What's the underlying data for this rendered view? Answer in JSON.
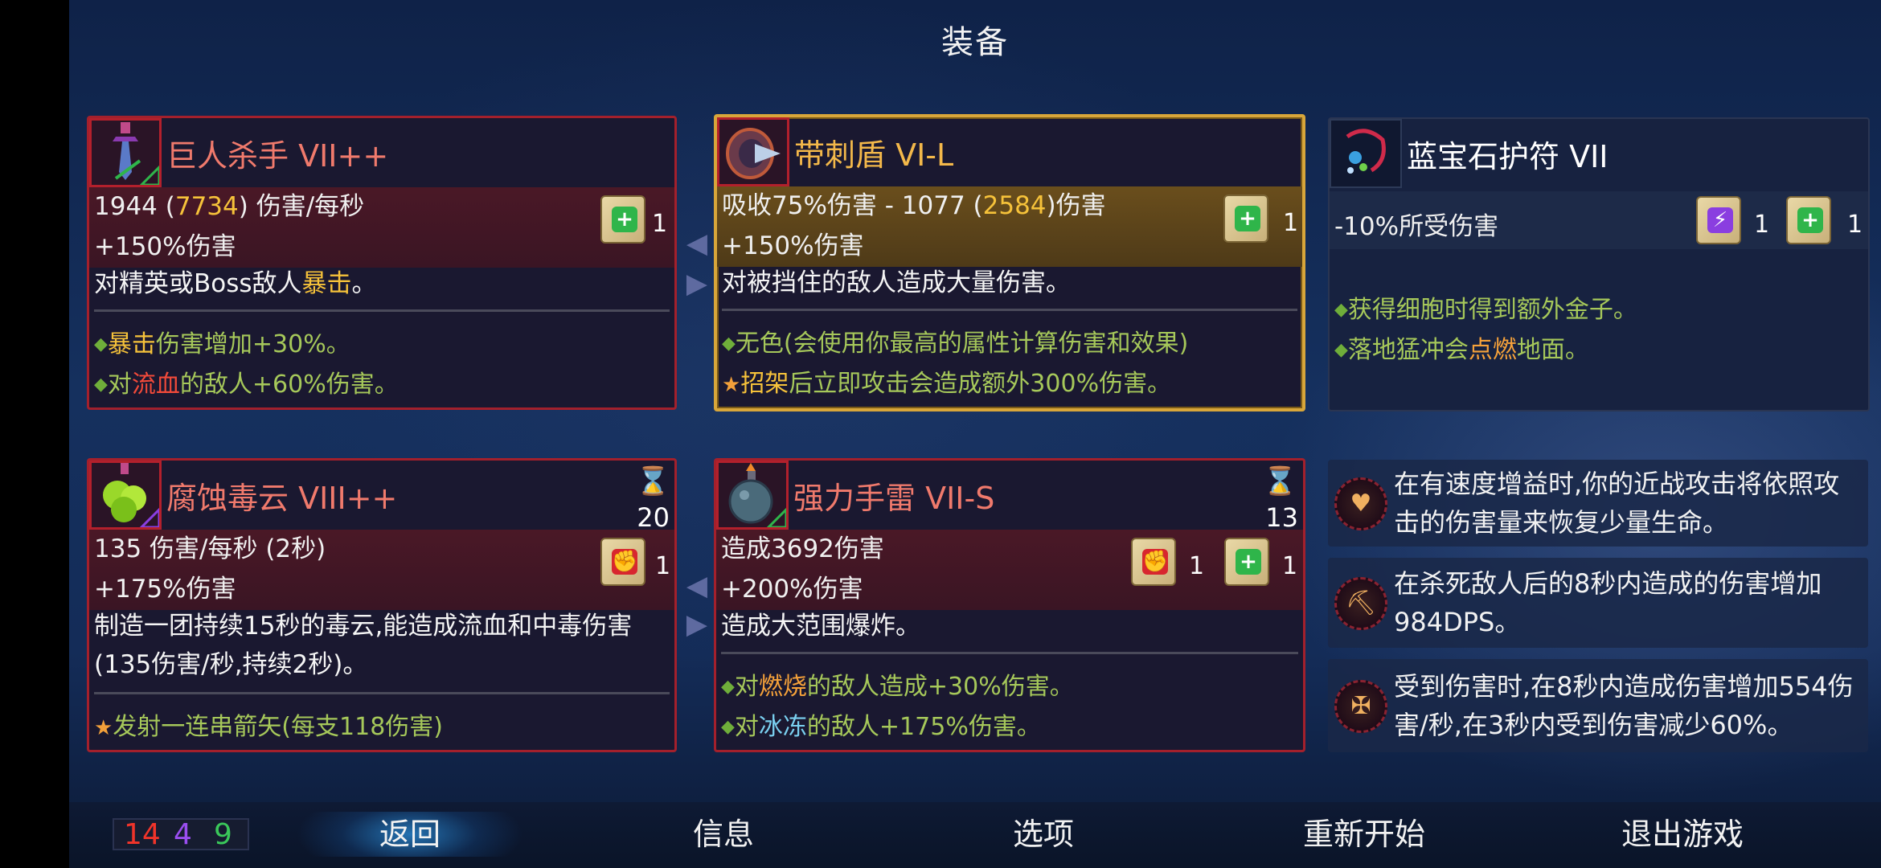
{
  "screen": {
    "title": "装备"
  },
  "colors": {
    "red_border": "#a3202c",
    "gold_border": "#d8a63a",
    "name_red": "#f07a6c",
    "name_gold": "#f3b84a",
    "mod_green": "#a6c85a"
  },
  "items": {
    "giant_killer": {
      "name": "巨人杀手 VII++",
      "icon": "sword-icon",
      "dps": "1944",
      "dps_alt": "7734",
      "dps_unit": "伤害/每秒",
      "bonus": "+150%伤害",
      "desc_pre": "对精英或Boss敌人",
      "desc_hl": "暴击",
      "desc_post": "。",
      "scroll_count": "1",
      "mod1_hl": "暴击",
      "mod1_post": "伤害增加+30%。",
      "mod2_pre": "对",
      "mod2_hl": "流血",
      "mod2_post": "的敌人+60%伤害。"
    },
    "spiked_shield": {
      "name": "带刺盾 VI-L",
      "icon": "spiked-shield-icon",
      "stat_pre": "吸收75%伤害 - 1077 (",
      "stat_hl": "2584",
      "stat_post": ")伤害",
      "bonus": "+150%伤害",
      "desc": "对被挡住的敌人造成大量伤害。",
      "scroll_count": "1",
      "mod1": "无色(会使用你最高的属性计算伤害和效果)",
      "mod2_hl": "招架",
      "mod2_post": "后立即攻击会造成额外300%伤害。"
    },
    "sapphire_amulet": {
      "name": "蓝宝石护符 VII",
      "icon": "amulet-icon",
      "stat": "-10%所受伤害",
      "scroll1_count": "1",
      "scroll2_count": "1",
      "mod1": "获得细胞时得到额外金子。",
      "mod2_pre": "落地猛冲会",
      "mod2_hl": "点燃",
      "mod2_post": "地面。"
    },
    "corrosive_cloud": {
      "name": "腐蚀毒云 VIII++",
      "icon": "poison-cloud-icon",
      "cooldown": "20",
      "stat": "135 伤害/每秒 (2秒)",
      "bonus": "+175%伤害",
      "desc": "制造一团持续15秒的毒云,能造成流血和中毒伤害(135伤害/秒,持续2秒)。",
      "scroll_count": "1",
      "mod1": "发射一连串箭矢(每支118伤害)"
    },
    "powerful_grenade": {
      "name": "强力手雷 VII-S",
      "icon": "grenade-icon",
      "cooldown": "13",
      "stat": "造成3692伤害",
      "bonus": "+200%伤害",
      "desc": "造成大范围爆炸。",
      "scroll1_count": "1",
      "scroll2_count": "1",
      "mod1_pre": "对",
      "mod1_hl": "燃烧",
      "mod1_post": "的敌人造成+30%伤害。",
      "mod2_pre": "对",
      "mod2_hl": "冰冻",
      "mod2_post": "的敌人+175%伤害。"
    }
  },
  "mutations": [
    {
      "icon": "heart-skull-icon",
      "text": "在有速度增益时,你的近战攻击将依照攻击的伤害量来恢复少量生命。"
    },
    {
      "icon": "pickaxe-icon",
      "text": "在杀死敌人后的8秒内造成的伤害增加984DPS。"
    },
    {
      "icon": "spiked-cross-icon",
      "text": "受到伤害时,在8秒内造成伤害增加554伤害/秒,在3秒内受到伤害减少60%。"
    }
  ],
  "stats": {
    "brutality": "14",
    "tactics": "4",
    "survival": "9"
  },
  "menu": {
    "back": "返回",
    "info": "信息",
    "options": "选项",
    "restart": "重新开始",
    "quit": "退出游戏"
  }
}
